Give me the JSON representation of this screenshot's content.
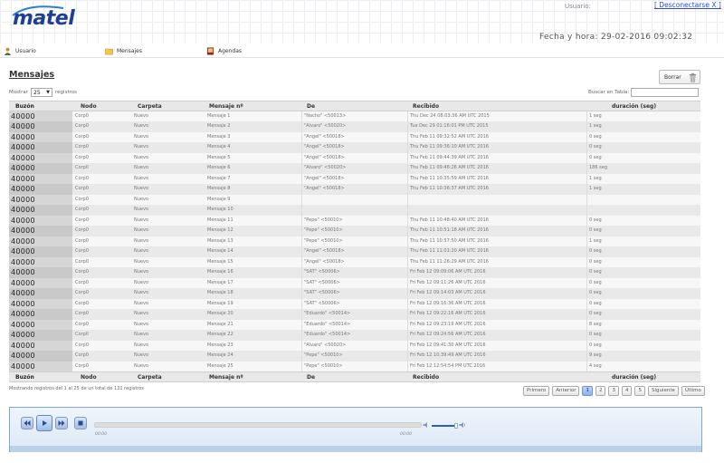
{
  "header": {
    "logo": "matel",
    "user_label": "Usuario:",
    "logout_label": "[ Desconectarse X ]",
    "datetime": "Fecha y hora: 29-02-2016 09:02:32"
  },
  "nav": {
    "items": [
      {
        "label": "Usuario",
        "icon": "user-icon"
      },
      {
        "label": "Mensajes",
        "icon": "folder-icon"
      },
      {
        "label": "Agendas",
        "icon": "book-icon"
      }
    ]
  },
  "panel": {
    "title": "Mensajes",
    "delete_label": "Borrar",
    "show_prefix": "Mostrar",
    "show_value": "25",
    "show_suffix": "registros",
    "search_label": "Buscar en Tabla:",
    "search_value": ""
  },
  "table": {
    "columns": [
      "Buzón",
      "Nodo",
      "Carpeta",
      "Mensaje nº",
      "De",
      "Recibido",
      "duración (seg)"
    ],
    "rows": [
      [
        "40000",
        "Corp0",
        "Nuevo",
        "Mensaje 1",
        "\"Nacho\" <50013>",
        "Thu Dec 24 08:03:36 AM UTC 2015",
        "1 seg"
      ],
      [
        "40000",
        "Corp0",
        "Nuevo",
        "Mensaje 2",
        "\"Alvaro\" <50020>",
        "Tue Dec 29 01:16:01 PM UTC 2015",
        "1 seg"
      ],
      [
        "40000",
        "Corp0",
        "Nuevo",
        "Mensaje 3",
        "\"Angel\" <50018>",
        "Thu Feb 11 09:32:52 AM UTC 2016",
        "0 seg"
      ],
      [
        "40000",
        "Corp0",
        "Nuevo",
        "Mensaje 4",
        "\"Angel\" <50018>",
        "Thu Feb 11 09:36:10 AM UTC 2016",
        "0 seg"
      ],
      [
        "40000",
        "Corp0",
        "Nuevo",
        "Mensaje 5",
        "\"Angel\" <50018>",
        "Thu Feb 11 09:44:39 AM UTC 2016",
        "0 seg"
      ],
      [
        "40000",
        "Corp0",
        "Nuevo",
        "Mensaje 6",
        "\"Alvaro\" <50020>",
        "Thu Feb 11 09:46:26 AM UTC 2016",
        "186 seg"
      ],
      [
        "40000",
        "Corp0",
        "Nuevo",
        "Mensaje 7",
        "\"Angel\" <50018>",
        "Thu Feb 11 10:35:59 AM UTC 2016",
        "1 seg"
      ],
      [
        "40000",
        "Corp0",
        "Nuevo",
        "Mensaje 8",
        "\"Angel\" <50018>",
        "Thu Feb 11 10:36:37 AM UTC 2016",
        "1 seg"
      ],
      [
        "40000",
        "Corp0",
        "Nuevo",
        "Mensaje 9",
        "",
        "",
        ""
      ],
      [
        "40000",
        "Corp0",
        "Nuevo",
        "Mensaje 10",
        "",
        "",
        ""
      ],
      [
        "40000",
        "Corp0",
        "Nuevo",
        "Mensaje 11",
        "\"Pepe\" <50010>",
        "Thu Feb 11 10:48:40 AM UTC 2016",
        "0 seg"
      ],
      [
        "40000",
        "Corp0",
        "Nuevo",
        "Mensaje 12",
        "\"Pepe\" <50010>",
        "Thu Feb 11 10:51:18 AM UTC 2016",
        "0 seg"
      ],
      [
        "40000",
        "Corp0",
        "Nuevo",
        "Mensaje 13",
        "\"Pepe\" <50010>",
        "Thu Feb 11 10:57:50 AM UTC 2016",
        "1 seg"
      ],
      [
        "40000",
        "Corp0",
        "Nuevo",
        "Mensaje 14",
        "\"Angel\" <50018>",
        "Thu Feb 11 11:01:20 AM UTC 2016",
        "0 seg"
      ],
      [
        "40000",
        "Corp0",
        "Nuevo",
        "Mensaje 15",
        "\"Angel\" <50018>",
        "Thu Feb 11 11:26:29 AM UTC 2016",
        "0 seg"
      ],
      [
        "40000",
        "Corp0",
        "Nuevo",
        "Mensaje 16",
        "\"SAT\" <50006>",
        "Fri Feb 12 09:09:06 AM UTC 2016",
        "0 seg"
      ],
      [
        "40000",
        "Corp0",
        "Nuevo",
        "Mensaje 17",
        "\"SAT\" <50006>",
        "Fri Feb 12 09:11:26 AM UTC 2016",
        "0 seg"
      ],
      [
        "40000",
        "Corp0",
        "Nuevo",
        "Mensaje 18",
        "\"SAT\" <50006>",
        "Fri Feb 12 09:14:03 AM UTC 2016",
        "0 seg"
      ],
      [
        "40000",
        "Corp0",
        "Nuevo",
        "Mensaje 19",
        "\"SAT\" <50006>",
        "Fri Feb 12 09:16:36 AM UTC 2016",
        "0 seg"
      ],
      [
        "40000",
        "Corp0",
        "Nuevo",
        "Mensaje 20",
        "\"Eduardo\" <50014>",
        "Fri Feb 12 09:22:16 AM UTC 2016",
        "0 seg"
      ],
      [
        "40000",
        "Corp0",
        "Nuevo",
        "Mensaje 21",
        "\"Eduardo\" <50014>",
        "Fri Feb 12 09:23:19 AM UTC 2016",
        "8 seg"
      ],
      [
        "40000",
        "Corp0",
        "Nuevo",
        "Mensaje 22",
        "\"Eduardo\" <50014>",
        "Fri Feb 12 09:24:56 AM UTC 2016",
        "0 seg"
      ],
      [
        "40000",
        "Corp0",
        "Nuevo",
        "Mensaje 23",
        "\"Alvaro\" <50020>",
        "Fri Feb 12 09:41:30 AM UTC 2016",
        "0 seg"
      ],
      [
        "40000",
        "Corp0",
        "Nuevo",
        "Mensaje 24",
        "\"Pepe\" <50010>",
        "Fri Feb 12 10:39:49 AM UTC 2016",
        "9 seg"
      ],
      [
        "40000",
        "Corp0",
        "Nuevo",
        "Mensaje 25",
        "\"Pepe\" <50010>",
        "Fri Feb 12 12:54:54 PM UTC 2016",
        "4 seg"
      ]
    ],
    "info": "Mostrando registros del 1 al 25 de un total de 131 registros"
  },
  "pager": {
    "first": "Primero",
    "prev": "Anterior",
    "pages": [
      "1",
      "2",
      "3",
      "4",
      "5"
    ],
    "active_page": "1",
    "next": "Siguiente",
    "last": "Último"
  },
  "player": {
    "time_left": "00:00",
    "time_right": "00:00",
    "progress": 0,
    "volume": 0.8
  }
}
